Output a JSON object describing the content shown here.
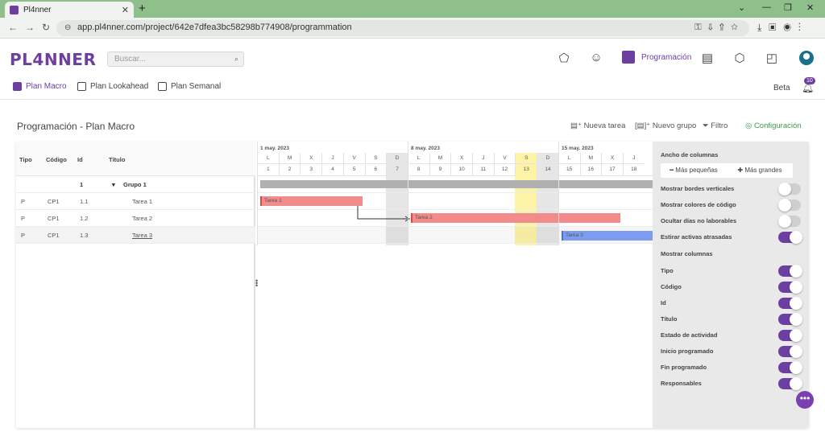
{
  "browser": {
    "tab_title": "Pl4nner",
    "url": "app.pl4nner.com/project/642e7dfea3bc58298b774908/programmation"
  },
  "app": {
    "logo": "PL4NNER",
    "search_placeholder": "Buscar...",
    "nav_active_label": "Programación",
    "subnav": [
      "Plan Macro",
      "Plan Lookahead",
      "Plan Semanal"
    ],
    "beta": "Beta",
    "notifications": "10"
  },
  "page": {
    "title": "Programación - Plan Macro",
    "toolbar": {
      "new_task": "Nueva tarea",
      "new_group": "Nuevo grupo",
      "filter": "Filtro",
      "config": "Configuración"
    }
  },
  "table": {
    "headers": [
      "Tipo",
      "Código",
      "Id",
      "Título"
    ],
    "rows": [
      {
        "tipo": "",
        "codigo": "",
        "id": "1",
        "titulo": "Grupo 1",
        "group": true
      },
      {
        "tipo": "P",
        "codigo": "CP1",
        "id": "1.1",
        "titulo": "Tarea 1"
      },
      {
        "tipo": "P",
        "codigo": "CP1",
        "id": "1.2",
        "titulo": "Tarea 2"
      },
      {
        "tipo": "P",
        "codigo": "CP1",
        "id": "1.3",
        "titulo": "Tarea 3"
      }
    ]
  },
  "gantt": {
    "weeks": [
      "1 may. 2023",
      "8 may. 2023",
      "15 may. 2023"
    ],
    "days": [
      {
        "l": "L",
        "n": "1"
      },
      {
        "l": "M",
        "n": "2"
      },
      {
        "l": "X",
        "n": "3"
      },
      {
        "l": "J",
        "n": "4"
      },
      {
        "l": "V",
        "n": "5"
      },
      {
        "l": "S",
        "n": "6"
      },
      {
        "l": "D",
        "n": "7"
      },
      {
        "l": "L",
        "n": "8"
      },
      {
        "l": "M",
        "n": "9"
      },
      {
        "l": "X",
        "n": "10"
      },
      {
        "l": "J",
        "n": "11"
      },
      {
        "l": "V",
        "n": "12"
      },
      {
        "l": "S",
        "n": "13"
      },
      {
        "l": "D",
        "n": "14"
      },
      {
        "l": "L",
        "n": "15"
      },
      {
        "l": "M",
        "n": "16"
      },
      {
        "l": "X",
        "n": "17"
      },
      {
        "l": "J",
        "n": "18"
      }
    ],
    "tasks": [
      {
        "name": "Tarea 1",
        "start": "1",
        "end": "5"
      },
      {
        "name": "Tarea 2",
        "start": "8",
        "end": "17"
      },
      {
        "name": "Tarea 3",
        "start": "15",
        "end": "18"
      }
    ],
    "bar_colors": {
      "task": "#f28b8b",
      "selected_task": "#7d9cf0",
      "group": "#b0b0b0",
      "today": "#fdf3a6",
      "weekend": "#e6e6e6"
    }
  },
  "settings": {
    "column_width_title": "Ancho de columnas",
    "smaller": "Más pequeñas",
    "larger": "Más grandes",
    "options": [
      {
        "label": "Mostrar bordes verticales",
        "on": false
      },
      {
        "label": "Mostrar colores de código",
        "on": false
      },
      {
        "label": "Ocultar días no laborables",
        "on": false
      },
      {
        "label": "Estirar activas atrasadas",
        "on": true
      }
    ],
    "columns_title": "Mostrar columnas",
    "columns": [
      {
        "label": "Tipo",
        "on": true
      },
      {
        "label": "Código",
        "on": true
      },
      {
        "label": "Id",
        "on": true
      },
      {
        "label": "Título",
        "on": true
      },
      {
        "label": "Estado de actividad",
        "on": true
      },
      {
        "label": "Inicio programado",
        "on": true
      },
      {
        "label": "Fin programado",
        "on": true
      },
      {
        "label": "Responsables",
        "on": true
      }
    ]
  },
  "colors": {
    "brand": "#6c3fa0",
    "config_green": "#3a9b4a"
  }
}
